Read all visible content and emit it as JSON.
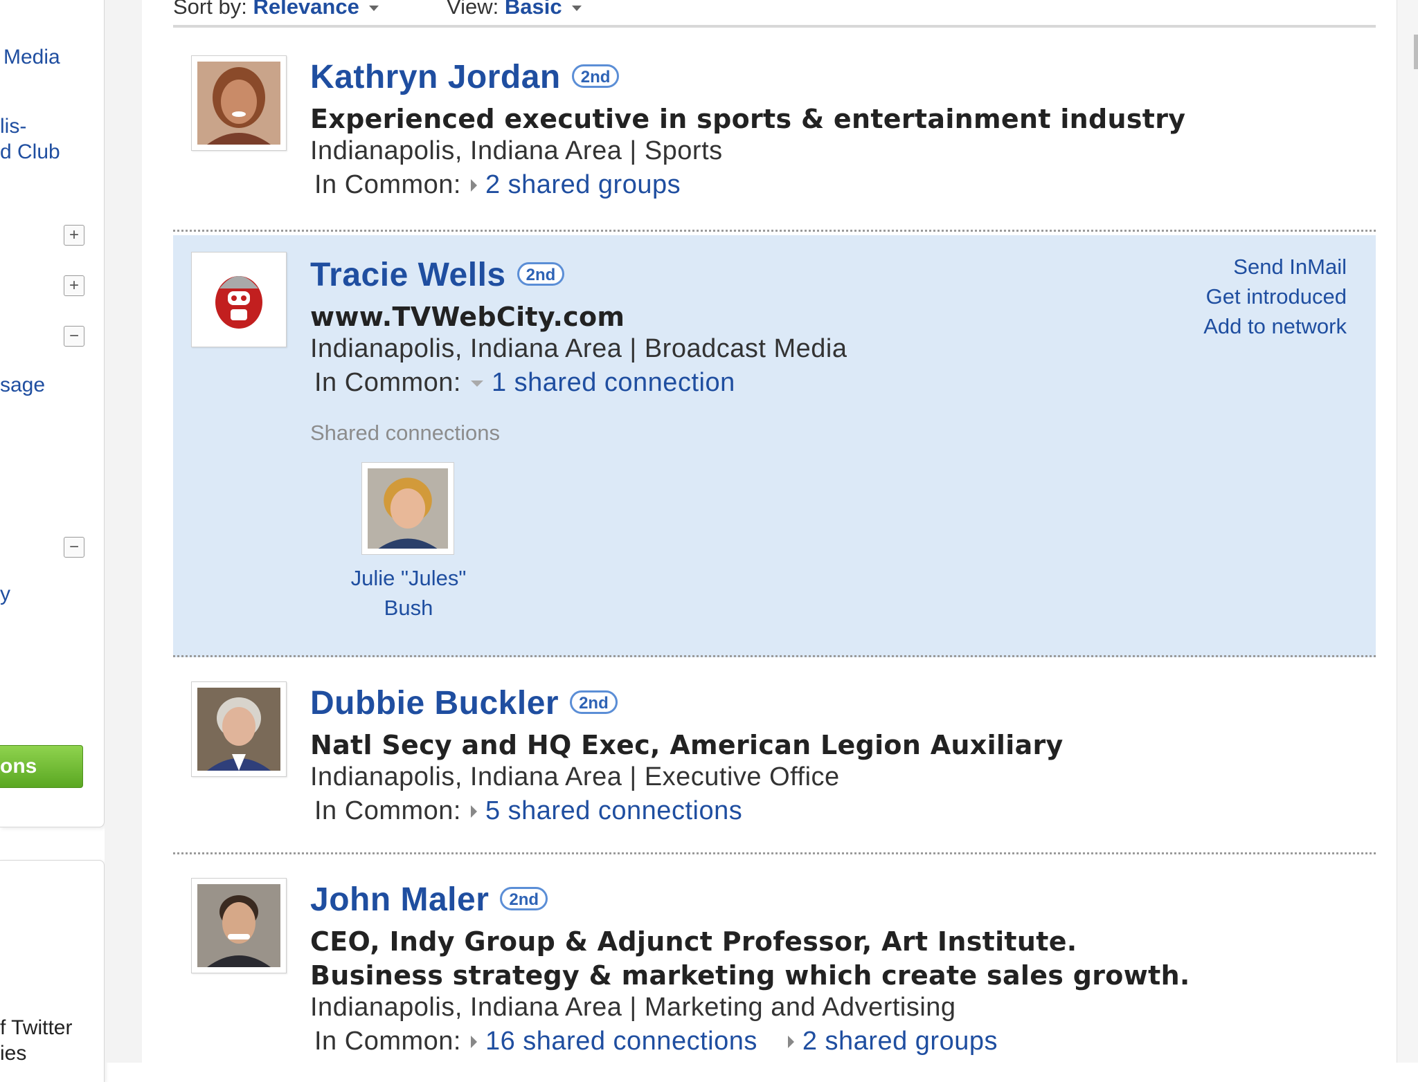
{
  "sidebar": {
    "lines": [
      "Media",
      "lis-",
      "d Club",
      "sage",
      "y",
      "ons",
      "f Twitter",
      "ies"
    ],
    "toggles": [
      "+",
      "+",
      "−",
      "−"
    ]
  },
  "toolbar": {
    "sort_label": "Sort by:",
    "sort_value": "Relevance",
    "view_label": "View:",
    "view_value": "Basic"
  },
  "results": [
    {
      "name": "Kathryn Jordan",
      "degree": "2nd",
      "headline": [
        "Experienced executive in sports & entertainment industry"
      ],
      "location": "Indianapolis, Indiana Area | Sports",
      "in_common_label": "In Common:",
      "in_common": [
        "2 shared groups"
      ]
    },
    {
      "name": "Tracie Wells",
      "degree": "2nd",
      "headline": [
        "www.TVWebCity.com"
      ],
      "location": "Indianapolis, Indiana Area | Broadcast Media",
      "in_common_label": "In Common:",
      "in_common": [
        "1 shared connection"
      ],
      "actions": [
        "Send InMail",
        "Get introduced",
        "Add to network"
      ],
      "shared_connections_label": "Shared connections",
      "shared_connection_name": [
        "Julie \"Jules\"",
        "Bush"
      ]
    },
    {
      "name": "Dubbie Buckler",
      "degree": "2nd",
      "headline": [
        "Natl Secy and HQ Exec, American Legion Auxiliary"
      ],
      "location": "Indianapolis, Indiana Area | Executive Office",
      "in_common_label": "In Common:",
      "in_common": [
        "5 shared connections"
      ]
    },
    {
      "name": "John Maler",
      "degree": "2nd",
      "headline": [
        "CEO, Indy Group & Adjunct Professor, Art Institute.",
        "Business strategy & marketing which create sales growth."
      ],
      "location": "Indianapolis, Indiana Area | Marketing and Advertising",
      "in_common_label": "In Common:",
      "in_common": [
        "16 shared connections",
        "2 shared groups"
      ]
    }
  ]
}
